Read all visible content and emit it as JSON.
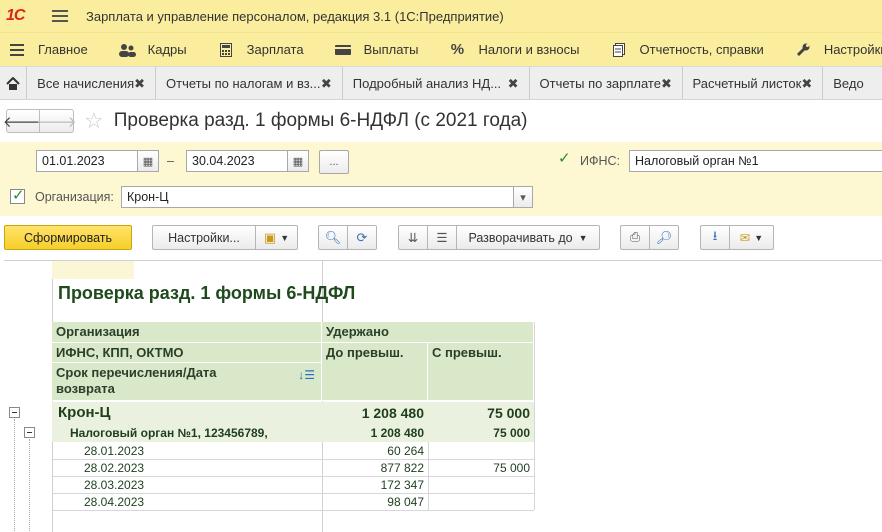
{
  "app": {
    "logo_text": "1С",
    "title": "Зарплата и управление персоналом, редакция 3.1  (1С:Предприятие)"
  },
  "sections": [
    {
      "label": "Главное",
      "icon": "menu-icon"
    },
    {
      "label": "Кадры",
      "icon": "people-icon"
    },
    {
      "label": "Зарплата",
      "icon": "calculator-icon"
    },
    {
      "label": "Выплаты",
      "icon": "wallet-icon"
    },
    {
      "label": "Налоги и взносы",
      "icon": "percent-icon"
    },
    {
      "label": "Отчетность, справки",
      "icon": "report-icon"
    },
    {
      "label": "Настройки",
      "icon": "wrench-icon"
    }
  ],
  "tabs": [
    {
      "label": "Все начисления"
    },
    {
      "label": "Отчеты по налогам и вз..."
    },
    {
      "label": "Подробный анализ НД..."
    },
    {
      "label": "Отчеты по зарплате"
    },
    {
      "label": "Расчетный листок"
    },
    {
      "label": "Ведо"
    }
  ],
  "form": {
    "title": "Проверка разд. 1 формы 6-НДФЛ (с 2021 года)"
  },
  "params": {
    "date_from": "01.01.2023",
    "date_sep": "–",
    "date_to": "30.04.2023",
    "period_btn": "...",
    "ifns_label": "ИФНС:",
    "ifns_value": "Налоговый орган №1",
    "ifns_checked": true,
    "org_label": "Организация:",
    "org_value": "Крон-Ц",
    "org_checked": true
  },
  "toolbar": {
    "generate": "Сформировать",
    "settings": "Настройки...",
    "expand": "Разворачивать до"
  },
  "report": {
    "title": "Проверка разд. 1 формы 6-НДФЛ",
    "headers": {
      "org": "Организация",
      "ifns": "ИФНС, КПП, ОКТМО",
      "date1": "Срок перечисления/Дата",
      "date2": "возврата",
      "withheld": "Удержано",
      "before": "До превыш.",
      "after": "С превыш."
    },
    "group1": {
      "name": "Крон-Ц",
      "before": "1 208 480",
      "after": "75 000"
    },
    "group2": {
      "name": "Налоговый орган №1, 123456789,",
      "before": "1 208 480",
      "after": "75 000"
    },
    "rows": [
      {
        "date": "28.01.2023",
        "before": "60 264",
        "after": ""
      },
      {
        "date": "28.02.2023",
        "before": "877 822",
        "after": "75 000"
      },
      {
        "date": "28.03.2023",
        "before": "172 347",
        "after": ""
      },
      {
        "date": "28.04.2023",
        "before": "98 047",
        "after": ""
      }
    ]
  }
}
